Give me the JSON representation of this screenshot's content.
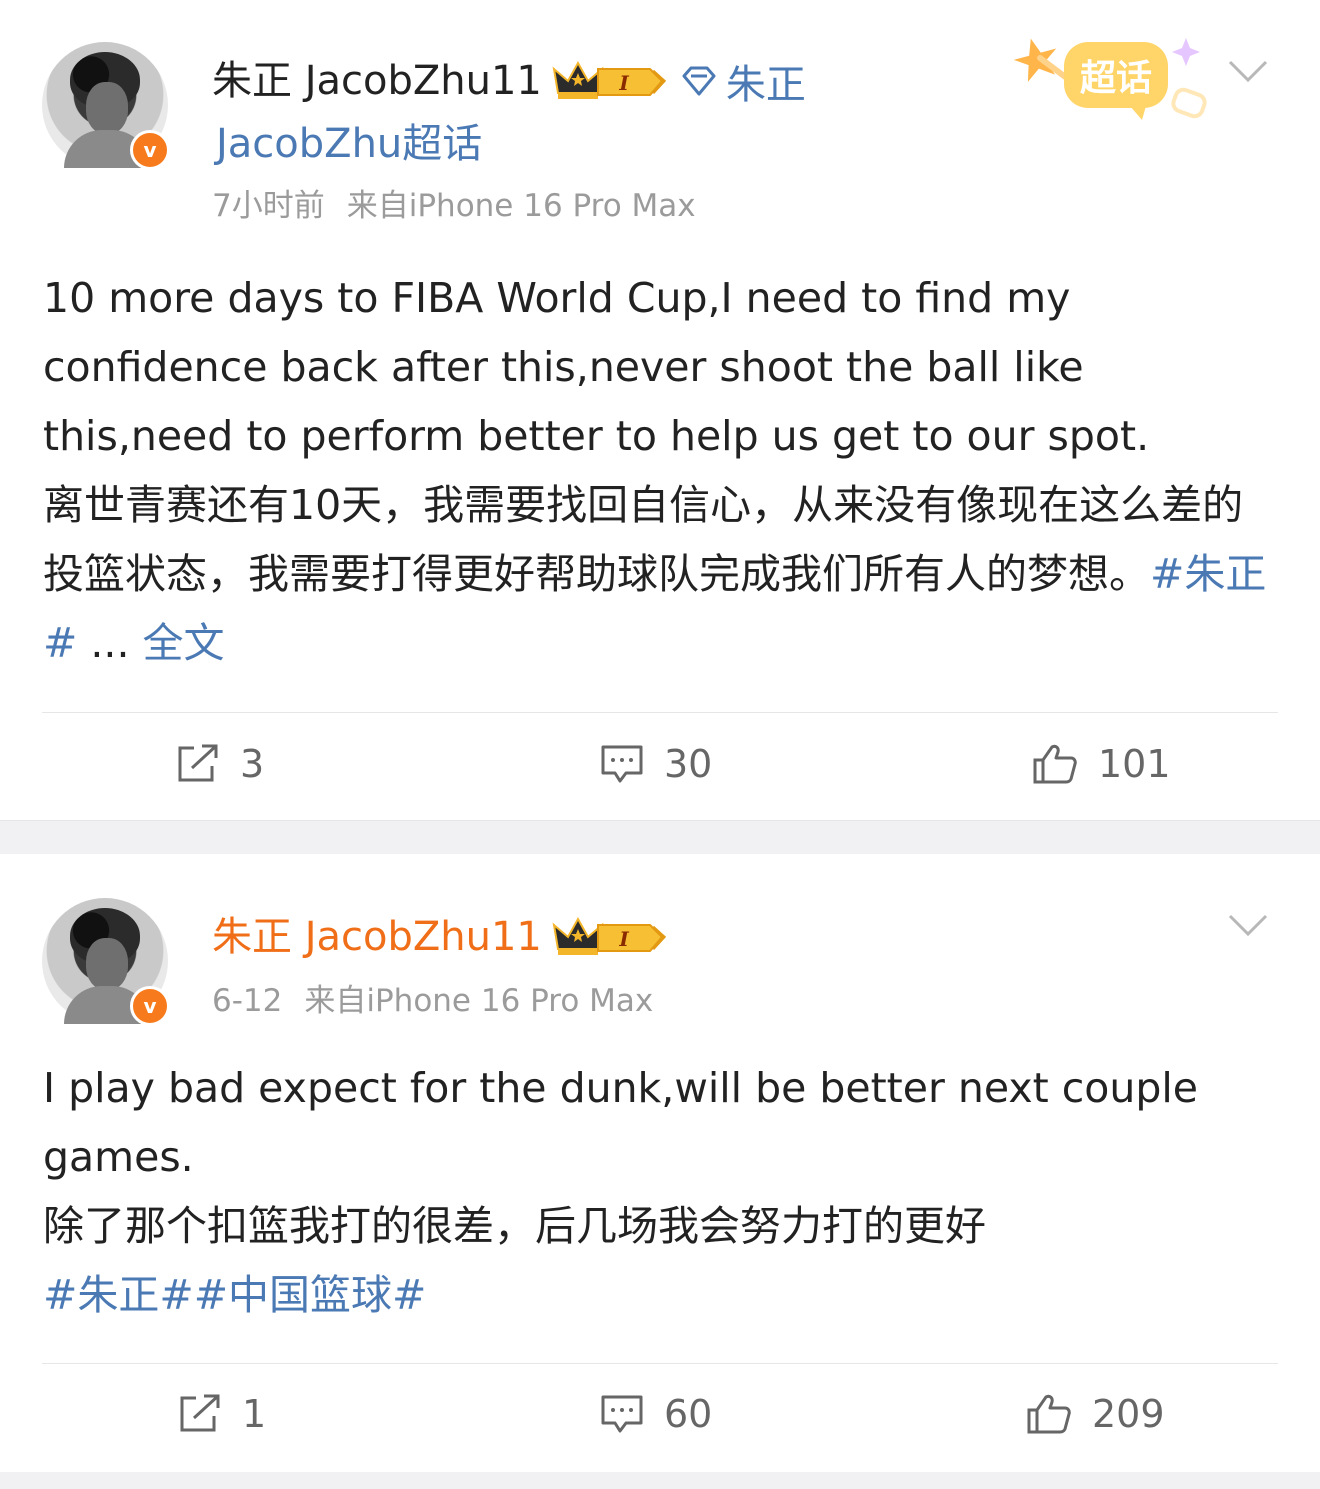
{
  "posts": [
    {
      "username": "朱正 JacobZhu11",
      "level_badge": "I",
      "supertopic_link": "朱正",
      "supertopic_link_line2": "JacobZhu超话",
      "supertopic_logo_text": "超话",
      "time": "7小时前",
      "source": "来自iPhone 16 Pro Max",
      "text_en": "10 more days to FIBA World Cup,I need to find my confidence back after this,never shoot the ball like this,need to perform better to help us get to our spot.",
      "text_zh": "离世青赛还有10天，我需要找回自信心，从来没有像现在这么差的投篮状态，我需要打得更好帮助球队完成我们所有人的梦想。",
      "hashtag": "#朱正#",
      "ellipsis": " ... ",
      "more_label": "全文",
      "reposts": "3",
      "comments": "30",
      "likes": "101"
    },
    {
      "username": "朱正 JacobZhu11",
      "level_badge": "I",
      "time": "6-12",
      "source": "来自iPhone 16 Pro Max",
      "text_en": "I play bad expect for the dunk,will be better next couple games.",
      "text_zh": "除了那个扣篮我打的很差，后几场我会努力打的更好",
      "hashtags": "#朱正##中国篮球#",
      "reposts": "1",
      "comments": "60",
      "likes": "209"
    }
  ],
  "colors": {
    "link": "#4a79b4",
    "username_highlight": "#f06e17",
    "verified_badge": "#f77b1c",
    "meta_gray": "#9b9b9b",
    "separator": "#f1f1f3"
  },
  "icons": [
    "verified-v-icon",
    "crown-icon",
    "diamond-icon",
    "chevron-down-icon",
    "repost-icon",
    "comment-icon",
    "like-icon",
    "supertopic-logo"
  ]
}
